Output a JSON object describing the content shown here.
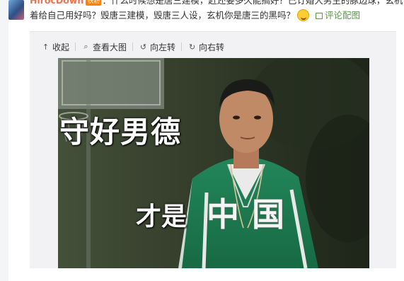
{
  "comment": {
    "username": "HirocDown",
    "badge": "铁粉",
    "line1": "：什么时候想是唐三建模，赶还要多久能搞好？已订婚大男主的豚边球，玄机留",
    "line2": "着给自己用好吗？毁唐三建模，毁唐三人设，玄机你是唐三的黑吗？",
    "pic_comment_link": "评论配图"
  },
  "toolbar": {
    "collapse": "收起",
    "view_large": "查看大图",
    "rotate_left": "向左转",
    "rotate_right": "向右转"
  },
  "image": {
    "caption_top": "守好男德",
    "caption_bottom": "才是",
    "jersey_text": "中国"
  },
  "colors": {
    "username": "#eb7350",
    "link_green": "#5a9a48",
    "jacket_green": "#1f7d4e"
  }
}
